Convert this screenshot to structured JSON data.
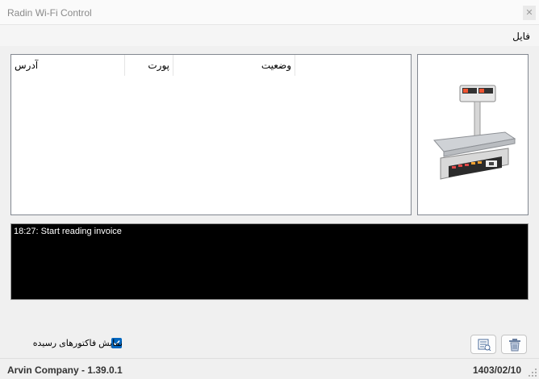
{
  "window": {
    "title": "Radin Wi-Fi Control"
  },
  "menu": {
    "file": "فایل"
  },
  "list": {
    "columns": [
      "آدرس",
      "پورت",
      "وضعیت"
    ],
    "rows": []
  },
  "image": {
    "icon": "scale-device-icon"
  },
  "log": {
    "lines": [
      "18:27: Start reading invoice"
    ]
  },
  "footer": {
    "show_received_invoices": "نمایش فاکتورهای رسیده",
    "show_received_checked": true
  },
  "buttons": {
    "report_icon": "report-icon",
    "delete_icon": "trash-icon"
  },
  "status": {
    "company": "Arvin Company - 1.39.0.1",
    "date": "1403/02/10"
  },
  "colors": {
    "accent": "#0067c0",
    "log_background": "#000000",
    "log_text": "#ffffff"
  }
}
